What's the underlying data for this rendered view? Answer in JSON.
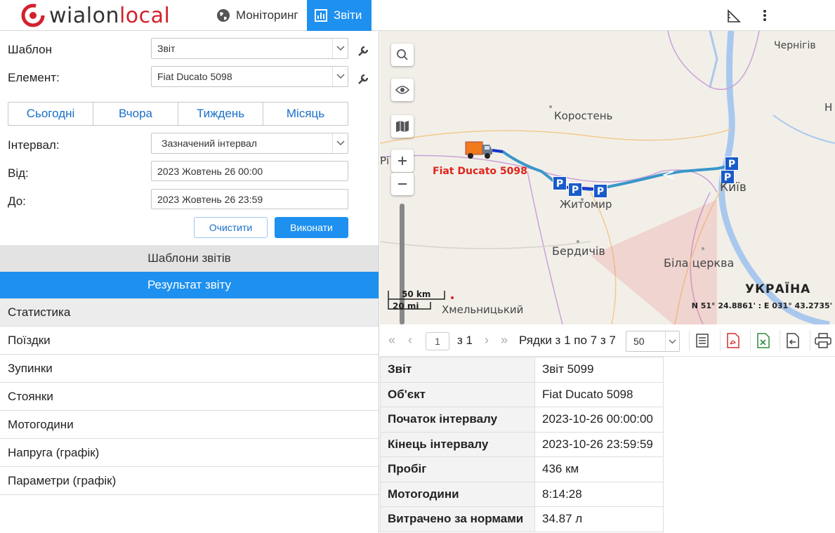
{
  "app": {
    "logo_text_a": "wi",
    "logo_text_b": "alon",
    "logo_text_c": "local",
    "tabs": [
      {
        "label": "Моніторинг",
        "icon": "globe-icon",
        "active": false
      },
      {
        "label": "Звіти",
        "icon": "report-icon",
        "active": true
      }
    ],
    "accent_color": "#1e90ef"
  },
  "form": {
    "template_label": "Шаблон",
    "template_value": "Звіт",
    "element_label": "Елемент:",
    "element_value": "Fiat Ducato 5098",
    "periods": [
      "Сьогодні",
      "Вчора",
      "Тиждень",
      "Місяць"
    ],
    "interval_label": "Інтервал:",
    "interval_value": "Зазначений інтервал",
    "from_label": "Від:",
    "from_value": "2023 Жовтень 26 00:00",
    "to_label": "До:",
    "to_value": "2023 Жовтень 26 23:59",
    "clear_label": "Очистити",
    "run_label": "Виконати"
  },
  "sections": {
    "templates": "Шаблони звітів",
    "result": "Результат звіту"
  },
  "result_items": [
    "Статистика",
    "Поїздки",
    "Зупинки",
    "Стоянки",
    "Мотогодини",
    "Напруга (графік)",
    "Параметри (графік)"
  ],
  "map": {
    "cities": {
      "chernihiv": "Чернігів",
      "korosten": "Коростень",
      "kyiv": "Київ",
      "zhytomyr": "Житомир",
      "berdychiv": "Бердичів",
      "bila_tserkva": "Біла церква",
      "khmelnytskyi": "Хмельницький",
      "ri": "Рі",
      "n": "Н",
      "country": "УКРАЇНА"
    },
    "unit_label": "Fiat Ducato 5098",
    "scale_km": "50 km",
    "scale_mi": "20 mi",
    "coordinates": "N 51° 24.8861' : E 031° 43.2735'",
    "parking_marker": "P"
  },
  "pagination": {
    "current_page": "1",
    "of_pages": "з 1",
    "rows_info": "Рядки з 1 по 7 з 7",
    "rows_per_page": "50"
  },
  "stats": [
    {
      "key": "Звіт",
      "value": "Звіт 5099"
    },
    {
      "key": "Об'єкт",
      "value": "Fiat Ducato 5098"
    },
    {
      "key": "Початок інтервалу",
      "value": "2023-10-26 00:00:00"
    },
    {
      "key": "Кінець інтервалу",
      "value": "2023-10-26 23:59:59"
    },
    {
      "key": "Пробіг",
      "value": "436 км"
    },
    {
      "key": "Мотогодини",
      "value": "8:14:28"
    },
    {
      "key": "Витрачено за нормами",
      "value": "34.87 л"
    }
  ]
}
